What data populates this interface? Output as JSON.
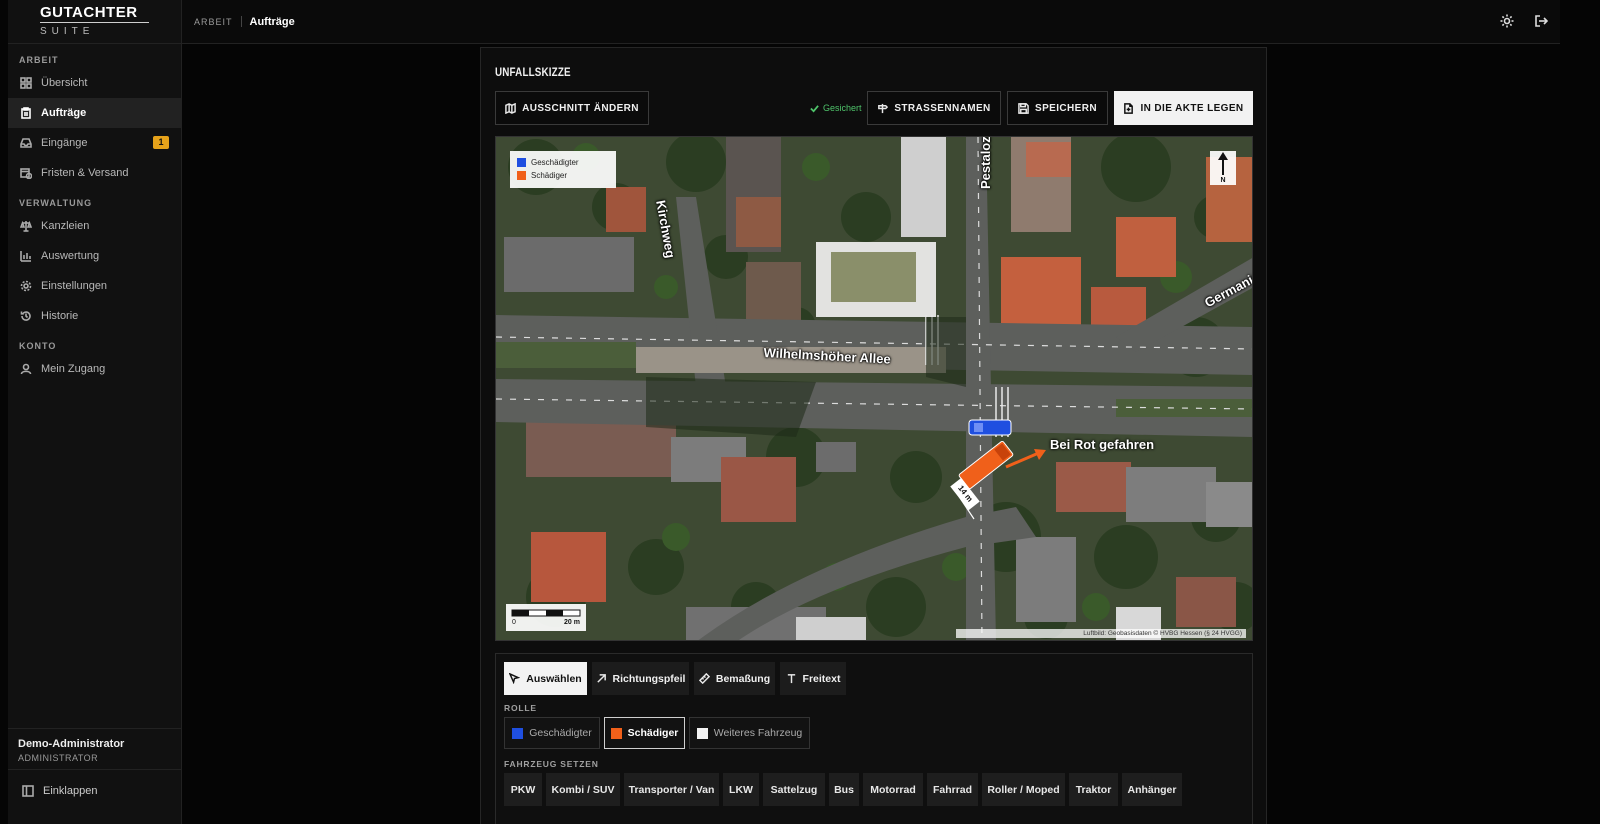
{
  "brand": {
    "main": "GUTACHTER",
    "sub": "SUITE"
  },
  "sidebar": {
    "sections": [
      {
        "label": "ARBEIT",
        "items": [
          {
            "label": "Übersicht",
            "icon": "grid-icon"
          },
          {
            "label": "Aufträge",
            "icon": "clipboard-icon",
            "active": true
          },
          {
            "label": "Eingänge",
            "icon": "inbox-icon",
            "badge": "1"
          },
          {
            "label": "Fristen & Versand",
            "icon": "calendar-clock-icon"
          }
        ]
      },
      {
        "label": "VERWALTUNG",
        "items": [
          {
            "label": "Kanzleien",
            "icon": "scale-icon"
          },
          {
            "label": "Auswertung",
            "icon": "bar-chart-icon"
          },
          {
            "label": "Einstellungen",
            "icon": "gear-icon"
          },
          {
            "label": "Historie",
            "icon": "history-icon"
          }
        ]
      },
      {
        "label": "KONTO",
        "items": [
          {
            "label": "Mein Zugang",
            "icon": "user-icon"
          }
        ]
      }
    ],
    "user": {
      "name": "Demo-Administrator",
      "role": "ADMINISTRATOR"
    },
    "collapse_label": "Einklappen"
  },
  "topbar": {
    "section": "ARBEIT",
    "page": "Aufträge"
  },
  "panel": {
    "title": "UNFALLSKIZZE",
    "change_view_label": "AUSSCHNITT ÄNDERN",
    "saved_status": "Gesichert",
    "street_names_label": "STRASSENNAMEN",
    "save_label": "SPEICHERN",
    "file_label": "IN DIE AKTE LEGEN"
  },
  "map": {
    "legend": [
      {
        "label": "Geschädigter",
        "color": "#1f4fe0"
      },
      {
        "label": "Schädiger",
        "color": "#f0601a"
      }
    ],
    "north_label": "N",
    "scale": {
      "start": "0",
      "end": "20 m"
    },
    "attribution": "Luftbild: Geobasisdaten © HVBG Hessen (§ 24 HVGG)",
    "street_labels": {
      "kirchweg": "Kirchweg",
      "pestalozzi": "Pestaloz",
      "germania": "Germania",
      "wilhelmshoeher": "Wilhelmshöher Allee"
    },
    "annotation": "Bei Rot gefahren",
    "measurement": "14 m"
  },
  "tools": {
    "modes": [
      {
        "label": "Auswählen",
        "icon": "cursor-icon",
        "selected": true
      },
      {
        "label": "Richtungspfeil",
        "icon": "arrow-up-right-icon"
      },
      {
        "label": "Bemaßung",
        "icon": "ruler-icon"
      },
      {
        "label": "Freitext",
        "icon": "text-icon"
      }
    ],
    "role_section": "ROLLE",
    "roles": [
      {
        "label": "Geschädigter",
        "color": "#1f4fe0"
      },
      {
        "label": "Schädiger",
        "color": "#f0601a",
        "selected": true
      },
      {
        "label": "Weiteres Fahrzeug",
        "color": "#f2f2f2"
      }
    ],
    "vehicle_section": "FAHRZEUG SETZEN",
    "vehicles": [
      "PKW",
      "Kombi / SUV",
      "Transporter / Van",
      "LKW",
      "Sattelzug",
      "Bus",
      "Motorrad",
      "Fahrrad",
      "Roller / Moped",
      "Traktor",
      "Anhänger"
    ]
  }
}
